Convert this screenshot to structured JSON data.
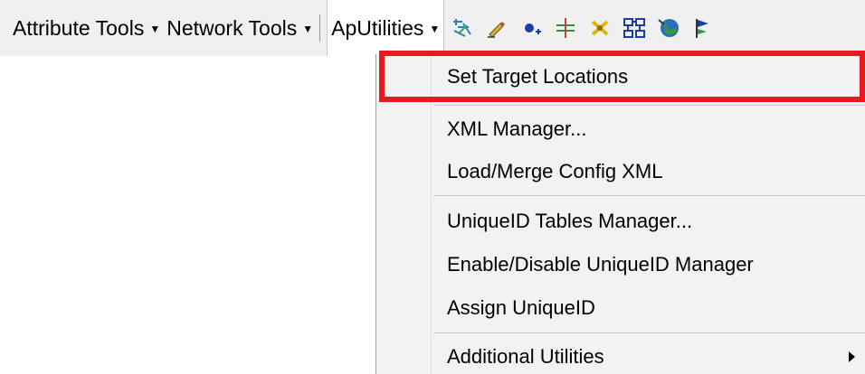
{
  "toolbar": {
    "menus": [
      {
        "label": "Attribute Tools"
      },
      {
        "label": "Network Tools"
      },
      {
        "label": "ApUtilities"
      }
    ],
    "icons": [
      "trace-network-icon",
      "edit-pencil-icon",
      "add-point-icon",
      "split-line-icon",
      "clear-flags-icon",
      "network-diagram-icon",
      "globe-icon",
      "flag-icon"
    ]
  },
  "dropdown": {
    "items": [
      {
        "label": "Set Target Locations"
      },
      {
        "label": "XML Manager..."
      },
      {
        "label": "Load/Merge Config XML"
      },
      {
        "label": "UniqueID Tables Manager..."
      },
      {
        "label": "Enable/Disable UniqueID Manager"
      },
      {
        "label": "Assign UniqueID"
      },
      {
        "label": "Additional Utilities"
      }
    ]
  },
  "colors": {
    "highlight": "#e8191f",
    "toolbar_bg": "#f0f0f0",
    "menu_bg": "#f2f2f2"
  }
}
